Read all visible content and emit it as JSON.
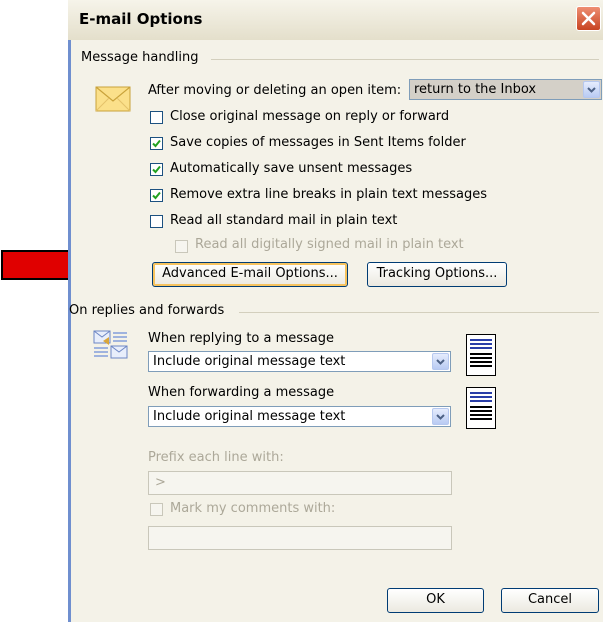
{
  "dialog": {
    "title": "E-mail Options",
    "colors": {
      "accent": "#1c5180",
      "close": "#d9532c",
      "arrow": "#e00000"
    }
  },
  "message_handling": {
    "label": "Message handling",
    "after_moving_label": "After moving or deleting an open item:",
    "after_moving_value": "return to the Inbox",
    "options": [
      {
        "label": "Close original message on reply or forward",
        "checked": false,
        "disabled": false
      },
      {
        "label": "Save copies of messages in Sent Items folder",
        "checked": true,
        "disabled": false
      },
      {
        "label": "Automatically save unsent messages",
        "checked": true,
        "disabled": false
      },
      {
        "label": "Remove extra line breaks in plain text messages",
        "checked": true,
        "disabled": false
      },
      {
        "label": "Read all standard mail in plain text",
        "checked": false,
        "disabled": false
      },
      {
        "label": "Read all digitally signed mail in plain text",
        "checked": false,
        "disabled": true
      }
    ],
    "advanced_button": "Advanced E-mail Options...",
    "tracking_button": "Tracking Options..."
  },
  "replies_forwards": {
    "label": "On replies and forwards",
    "reply_label": "When replying to a message",
    "reply_value": "Include original message text",
    "forward_label": "When forwarding a message",
    "forward_value": "Include original message text",
    "prefix_label": "Prefix each line with:",
    "prefix_value": ">",
    "mark_label": "Mark my comments with:",
    "mark_value": ""
  },
  "footer": {
    "ok": "OK",
    "cancel": "Cancel"
  },
  "icons": [
    "envelope-icon",
    "reply-forward-icon",
    "close-icon",
    "chevron-down-icon",
    "checkmark-icon",
    "red-arrow-icon",
    "message-preview-icon"
  ]
}
